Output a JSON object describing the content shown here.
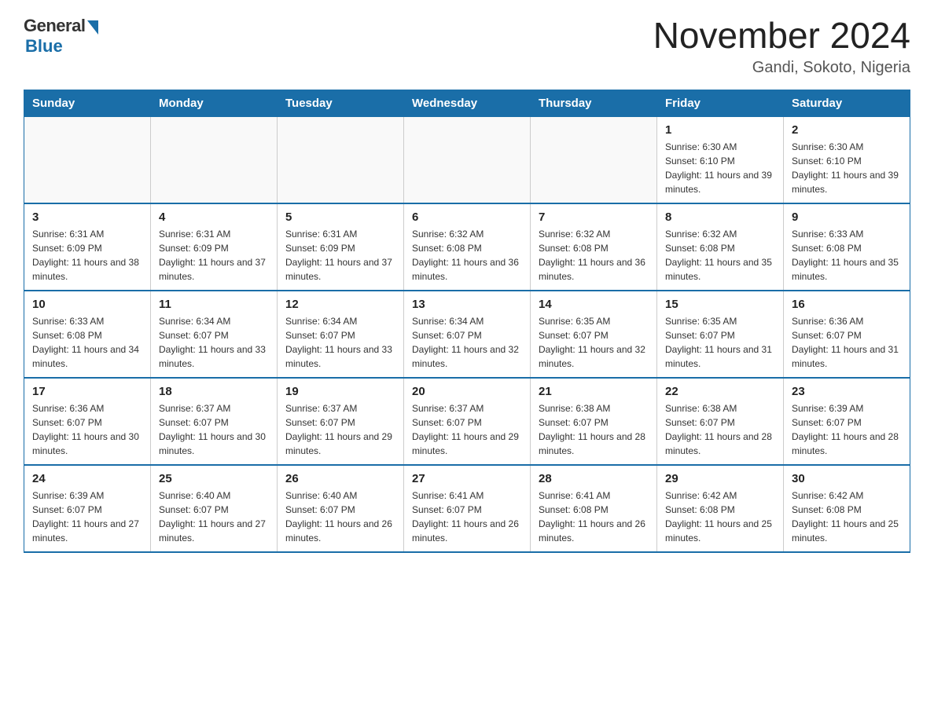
{
  "logo": {
    "general": "General",
    "blue": "Blue"
  },
  "header": {
    "month_year": "November 2024",
    "location": "Gandi, Sokoto, Nigeria"
  },
  "weekdays": [
    "Sunday",
    "Monday",
    "Tuesday",
    "Wednesday",
    "Thursday",
    "Friday",
    "Saturday"
  ],
  "weeks": [
    [
      {
        "day": "",
        "info": ""
      },
      {
        "day": "",
        "info": ""
      },
      {
        "day": "",
        "info": ""
      },
      {
        "day": "",
        "info": ""
      },
      {
        "day": "",
        "info": ""
      },
      {
        "day": "1",
        "info": "Sunrise: 6:30 AM\nSunset: 6:10 PM\nDaylight: 11 hours and 39 minutes."
      },
      {
        "day": "2",
        "info": "Sunrise: 6:30 AM\nSunset: 6:10 PM\nDaylight: 11 hours and 39 minutes."
      }
    ],
    [
      {
        "day": "3",
        "info": "Sunrise: 6:31 AM\nSunset: 6:09 PM\nDaylight: 11 hours and 38 minutes."
      },
      {
        "day": "4",
        "info": "Sunrise: 6:31 AM\nSunset: 6:09 PM\nDaylight: 11 hours and 37 minutes."
      },
      {
        "day": "5",
        "info": "Sunrise: 6:31 AM\nSunset: 6:09 PM\nDaylight: 11 hours and 37 minutes."
      },
      {
        "day": "6",
        "info": "Sunrise: 6:32 AM\nSunset: 6:08 PM\nDaylight: 11 hours and 36 minutes."
      },
      {
        "day": "7",
        "info": "Sunrise: 6:32 AM\nSunset: 6:08 PM\nDaylight: 11 hours and 36 minutes."
      },
      {
        "day": "8",
        "info": "Sunrise: 6:32 AM\nSunset: 6:08 PM\nDaylight: 11 hours and 35 minutes."
      },
      {
        "day": "9",
        "info": "Sunrise: 6:33 AM\nSunset: 6:08 PM\nDaylight: 11 hours and 35 minutes."
      }
    ],
    [
      {
        "day": "10",
        "info": "Sunrise: 6:33 AM\nSunset: 6:08 PM\nDaylight: 11 hours and 34 minutes."
      },
      {
        "day": "11",
        "info": "Sunrise: 6:34 AM\nSunset: 6:07 PM\nDaylight: 11 hours and 33 minutes."
      },
      {
        "day": "12",
        "info": "Sunrise: 6:34 AM\nSunset: 6:07 PM\nDaylight: 11 hours and 33 minutes."
      },
      {
        "day": "13",
        "info": "Sunrise: 6:34 AM\nSunset: 6:07 PM\nDaylight: 11 hours and 32 minutes."
      },
      {
        "day": "14",
        "info": "Sunrise: 6:35 AM\nSunset: 6:07 PM\nDaylight: 11 hours and 32 minutes."
      },
      {
        "day": "15",
        "info": "Sunrise: 6:35 AM\nSunset: 6:07 PM\nDaylight: 11 hours and 31 minutes."
      },
      {
        "day": "16",
        "info": "Sunrise: 6:36 AM\nSunset: 6:07 PM\nDaylight: 11 hours and 31 minutes."
      }
    ],
    [
      {
        "day": "17",
        "info": "Sunrise: 6:36 AM\nSunset: 6:07 PM\nDaylight: 11 hours and 30 minutes."
      },
      {
        "day": "18",
        "info": "Sunrise: 6:37 AM\nSunset: 6:07 PM\nDaylight: 11 hours and 30 minutes."
      },
      {
        "day": "19",
        "info": "Sunrise: 6:37 AM\nSunset: 6:07 PM\nDaylight: 11 hours and 29 minutes."
      },
      {
        "day": "20",
        "info": "Sunrise: 6:37 AM\nSunset: 6:07 PM\nDaylight: 11 hours and 29 minutes."
      },
      {
        "day": "21",
        "info": "Sunrise: 6:38 AM\nSunset: 6:07 PM\nDaylight: 11 hours and 28 minutes."
      },
      {
        "day": "22",
        "info": "Sunrise: 6:38 AM\nSunset: 6:07 PM\nDaylight: 11 hours and 28 minutes."
      },
      {
        "day": "23",
        "info": "Sunrise: 6:39 AM\nSunset: 6:07 PM\nDaylight: 11 hours and 28 minutes."
      }
    ],
    [
      {
        "day": "24",
        "info": "Sunrise: 6:39 AM\nSunset: 6:07 PM\nDaylight: 11 hours and 27 minutes."
      },
      {
        "day": "25",
        "info": "Sunrise: 6:40 AM\nSunset: 6:07 PM\nDaylight: 11 hours and 27 minutes."
      },
      {
        "day": "26",
        "info": "Sunrise: 6:40 AM\nSunset: 6:07 PM\nDaylight: 11 hours and 26 minutes."
      },
      {
        "day": "27",
        "info": "Sunrise: 6:41 AM\nSunset: 6:07 PM\nDaylight: 11 hours and 26 minutes."
      },
      {
        "day": "28",
        "info": "Sunrise: 6:41 AM\nSunset: 6:08 PM\nDaylight: 11 hours and 26 minutes."
      },
      {
        "day": "29",
        "info": "Sunrise: 6:42 AM\nSunset: 6:08 PM\nDaylight: 11 hours and 25 minutes."
      },
      {
        "day": "30",
        "info": "Sunrise: 6:42 AM\nSunset: 6:08 PM\nDaylight: 11 hours and 25 minutes."
      }
    ]
  ]
}
